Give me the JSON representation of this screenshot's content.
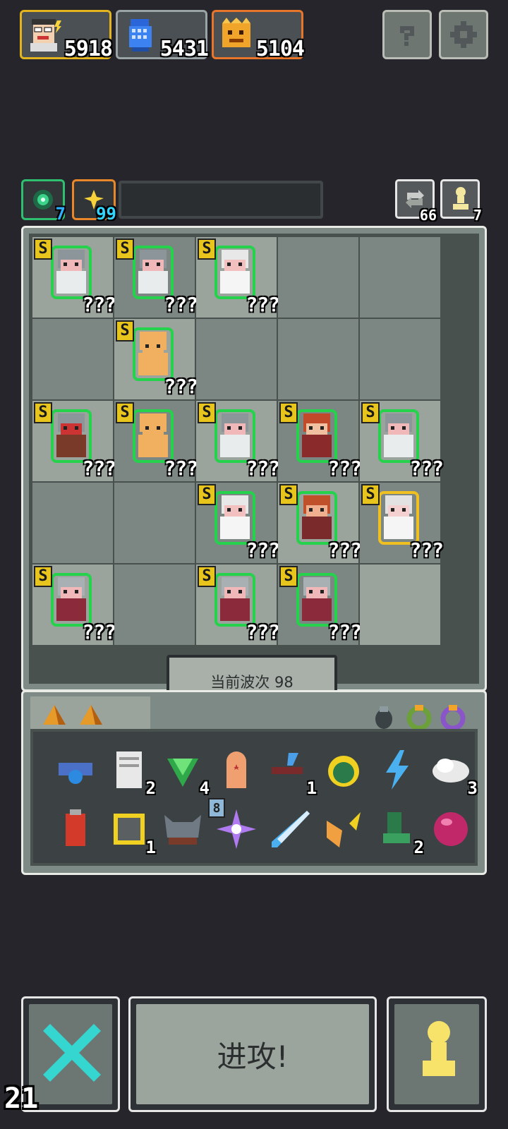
{
  "resources": [
    {
      "name": "commander",
      "value": "5918",
      "border": "#e3b41e"
    },
    {
      "name": "building",
      "value": "5431",
      "border": "#9aa3a6"
    },
    {
      "name": "monster",
      "value": "5104",
      "border": "#e8762a"
    }
  ],
  "top_buttons": {
    "help_icon": "question-icon",
    "settings_icon": "gear-icon"
  },
  "stats": [
    {
      "value": "7",
      "border": "#2fbf71"
    },
    {
      "value": "99",
      "border": "#e8882a"
    }
  ],
  "right_buttons": [
    {
      "icon": "refresh-icon",
      "value": "66"
    },
    {
      "icon": "pawn-icon",
      "value": "7"
    }
  ],
  "board": {
    "wave_label": "当前波次 98",
    "units": [
      {
        "row": 0,
        "col": 0,
        "grade": "S",
        "level": "???",
        "type": "knight"
      },
      {
        "row": 0,
        "col": 1,
        "grade": "S",
        "level": "???",
        "type": "knight"
      },
      {
        "row": 0,
        "col": 2,
        "grade": "S",
        "level": "???",
        "type": "priest"
      },
      {
        "row": 1,
        "col": 1,
        "grade": "S",
        "level": "???",
        "type": "golem"
      },
      {
        "row": 2,
        "col": 0,
        "grade": "S",
        "level": "???",
        "type": "shield"
      },
      {
        "row": 2,
        "col": 1,
        "grade": "S",
        "level": "???",
        "type": "golem"
      },
      {
        "row": 2,
        "col": 2,
        "grade": "S",
        "level": "???",
        "type": "knight"
      },
      {
        "row": 2,
        "col": 3,
        "grade": "S",
        "level": "???",
        "type": "general"
      },
      {
        "row": 2,
        "col": 4,
        "grade": "S",
        "level": "???",
        "type": "knight"
      },
      {
        "row": 3,
        "col": 2,
        "grade": "S",
        "level": "???",
        "type": "priest"
      },
      {
        "row": 3,
        "col": 3,
        "grade": "S",
        "level": "???",
        "type": "warrior"
      },
      {
        "row": 3,
        "col": 4,
        "grade": "S",
        "level": "???",
        "type": "angel"
      },
      {
        "row": 4,
        "col": 0,
        "grade": "S",
        "level": "???",
        "type": "maiden"
      },
      {
        "row": 4,
        "col": 2,
        "grade": "S",
        "level": "???",
        "type": "maiden"
      },
      {
        "row": 4,
        "col": 3,
        "grade": "S",
        "level": "???",
        "type": "maiden"
      }
    ]
  },
  "inventory": {
    "tabs": [
      "tab-a",
      "tab-b"
    ],
    "filters": [
      "beetle-icon",
      "green-ring-icon",
      "purple-ring-icon"
    ],
    "items": [
      {
        "icon": "goggles-icon",
        "count": ""
      },
      {
        "icon": "scroll-icon",
        "count": "2"
      },
      {
        "icon": "emerald-icon",
        "count": "4"
      },
      {
        "icon": "tombstone-icon",
        "count": ""
      },
      {
        "icon": "blaster-icon",
        "count": "1"
      },
      {
        "icon": "potion-orb-icon",
        "count": ""
      },
      {
        "icon": "lightning-icon",
        "count": ""
      },
      {
        "icon": "cloud-icon",
        "count": "3"
      },
      {
        "icon": "battery-icon",
        "count": ""
      },
      {
        "icon": "chip-icon",
        "count": "1"
      },
      {
        "icon": "helmet-icon",
        "count": ""
      },
      {
        "icon": "spark-icon",
        "count": ""
      },
      {
        "icon": "blade-icon",
        "count": ""
      },
      {
        "icon": "fox-icon",
        "count": ""
      },
      {
        "icon": "boot-icon",
        "count": "2"
      },
      {
        "icon": "pink-orb-icon",
        "count": ""
      }
    ],
    "badge": "8"
  },
  "controls": {
    "cancel_icon": "x-icon",
    "attack_label": "进攻!",
    "pawn_icon": "pawn-icon",
    "counter": "21"
  }
}
